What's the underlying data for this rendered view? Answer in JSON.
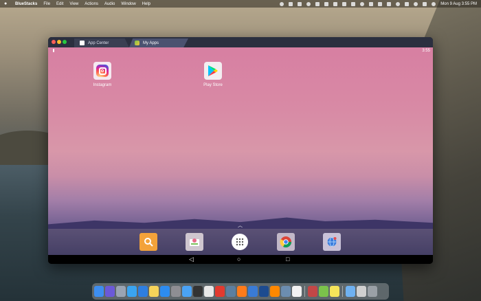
{
  "menubar": {
    "app_name": "BlueStacks",
    "menus": [
      "File",
      "Edit",
      "View",
      "Actions",
      "Audio",
      "Window",
      "Help"
    ],
    "datetime": "Mon 9 Aug  3:55 PM"
  },
  "window": {
    "tabs": [
      {
        "label": "App Center"
      },
      {
        "label": "My Apps"
      }
    ]
  },
  "android": {
    "time": "3:55",
    "apps": [
      {
        "label": "Instagram",
        "icon": "instagram-icon"
      },
      {
        "label": "Play Store",
        "icon": "play-store-icon"
      }
    ],
    "dock": [
      "search-icon",
      "gallery-icon",
      "app-drawer-icon",
      "chrome-icon",
      "browser-icon"
    ],
    "nav": {
      "back": "◁",
      "home": "○",
      "recent": "□"
    }
  },
  "mac_dock": {
    "items": [
      {
        "name": "finder-icon",
        "color": "#3d8ef0"
      },
      {
        "name": "siri-icon",
        "color": "#6b59d8"
      },
      {
        "name": "launchpad-icon",
        "color": "#9aa4b3"
      },
      {
        "name": "safari-icon",
        "color": "#3aa4f0"
      },
      {
        "name": "tasks-icon",
        "color": "#2e7ee0"
      },
      {
        "name": "notes-icon",
        "color": "#f5d35a"
      },
      {
        "name": "app-store-icon",
        "color": "#2d8cf0"
      },
      {
        "name": "settings-icon",
        "color": "#8e8e93"
      },
      {
        "name": "mail-icon",
        "color": "#4aa3f5"
      },
      {
        "name": "final-cut-icon",
        "color": "#333"
      },
      {
        "name": "chrome-icon",
        "color": "#e8e8e8"
      },
      {
        "name": "opera-icon",
        "color": "#e23a2f"
      },
      {
        "name": "preview-icon",
        "color": "#5c7fa0"
      },
      {
        "name": "firefox-icon",
        "color": "#ff7b1a"
      },
      {
        "name": "scrivener-icon",
        "color": "#3a7bd5"
      },
      {
        "name": "magnet-icon",
        "color": "#1d4b8f"
      },
      {
        "name": "vlc-icon",
        "color": "#ff8800"
      },
      {
        "name": "davinci-icon",
        "color": "#6c8db0"
      },
      {
        "name": "notion-icon",
        "color": "#f2f2f2"
      },
      {
        "name": "sep",
        "color": ""
      },
      {
        "name": "multi-instance-icon",
        "color": "#c24747"
      },
      {
        "name": "bluestacks-icon",
        "color": "#7bc24b"
      },
      {
        "name": "stickies-icon",
        "color": "#f5e45a"
      },
      {
        "name": "sep",
        "color": ""
      },
      {
        "name": "folder-icon",
        "color": "#6fb1f0"
      },
      {
        "name": "disk-icon",
        "color": "#d0d0d0"
      },
      {
        "name": "trash-icon",
        "color": "#9aa0a6"
      }
    ]
  }
}
